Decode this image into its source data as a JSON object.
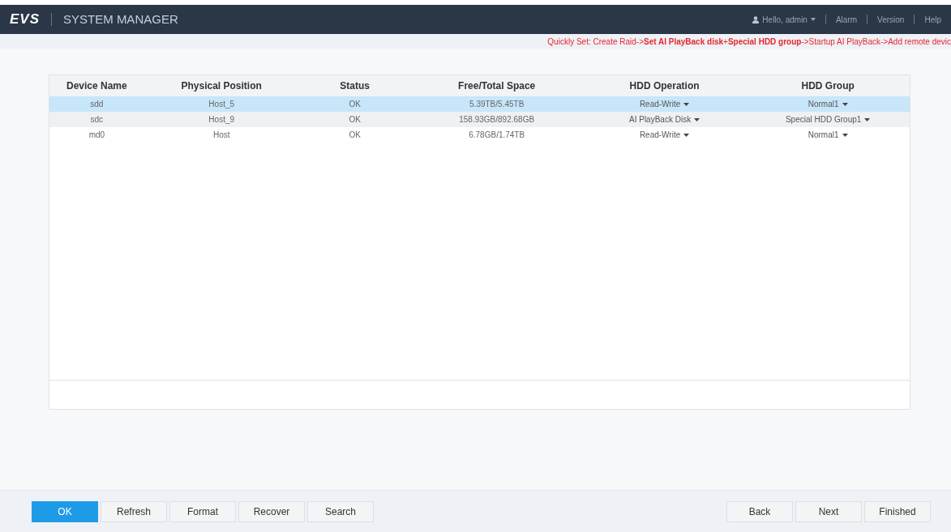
{
  "header": {
    "logo": "EVS",
    "title": "SYSTEM MANAGER",
    "user": "Hello, admin",
    "links": [
      "Alarm",
      "Version",
      "Help"
    ]
  },
  "breadcrumb": "Quickly Set: Create Raid->**Set AI PlayBack disk**+**Special HDD group**->Startup AI PlayBack->Add remote devic",
  "table": {
    "columns": [
      "Device Name",
      "Physical Position",
      "Status",
      "Free/Total Space",
      "HDD Operation",
      "HDD Group"
    ],
    "rows": [
      {
        "selected": true,
        "cells": [
          "sdd",
          "Host_5",
          "OK",
          "5.39TB/5.45TB",
          "Read-Write",
          "Normal1"
        ]
      },
      {
        "selected": false,
        "cells": [
          "sdc",
          "Host_9",
          "OK",
          "158.93GB/892.68GB",
          "AI PlayBack Disk",
          "Special HDD Group1"
        ]
      },
      {
        "selected": false,
        "cells": [
          "md0",
          "Host",
          "OK",
          "6.78GB/1.74TB",
          "Read-Write",
          "Normal1"
        ]
      }
    ]
  },
  "left_buttons": [
    {
      "label": "OK",
      "primary": true
    },
    {
      "label": "Refresh",
      "primary": false
    },
    {
      "label": "Format",
      "primary": false
    },
    {
      "label": "Recover",
      "primary": false
    },
    {
      "label": "Search",
      "primary": false
    }
  ],
  "right_buttons": [
    "Back",
    "Next",
    "Finished"
  ]
}
